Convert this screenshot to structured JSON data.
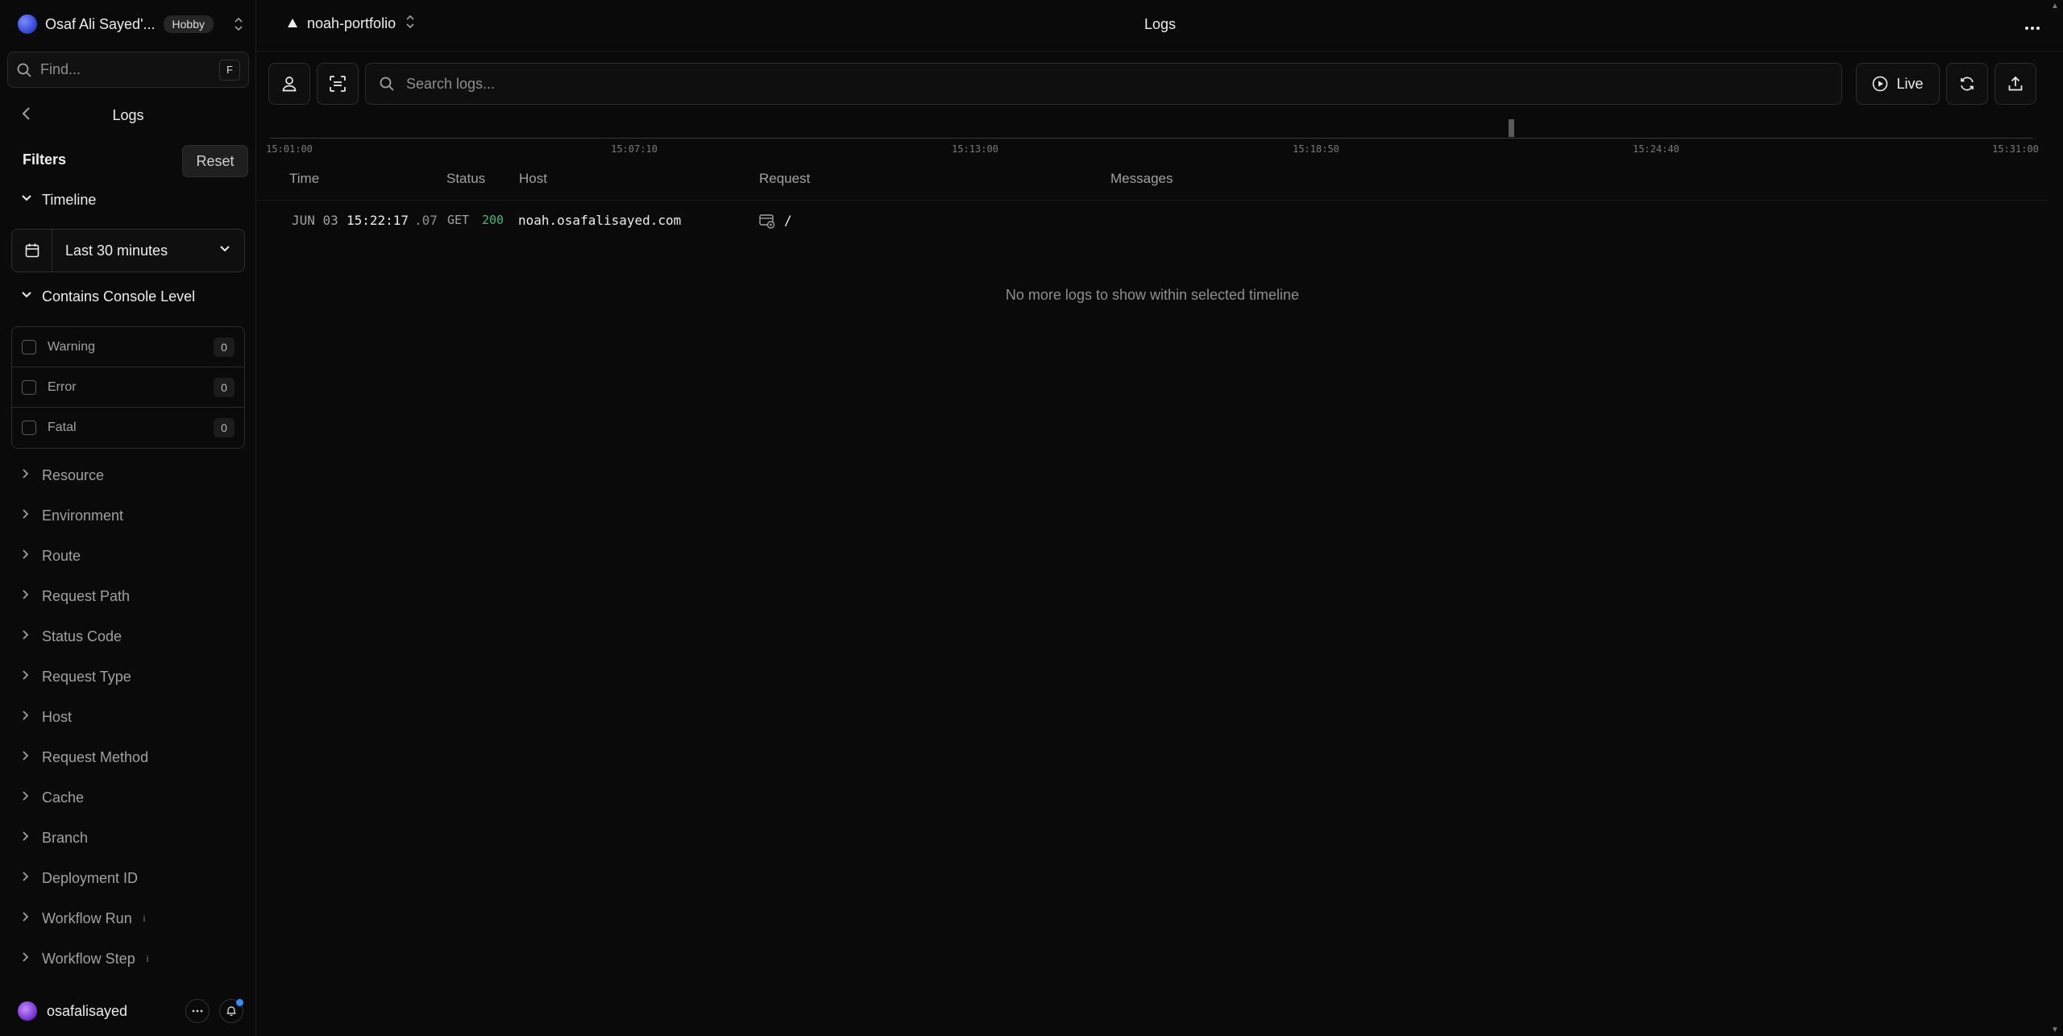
{
  "sidebar": {
    "team_name": "Osaf Ali Sayed'...",
    "plan_badge": "Hobby",
    "find_placeholder": "Find...",
    "find_shortcut": "F",
    "section_title": "Logs",
    "filters_heading": "Filters",
    "reset_label": "Reset",
    "timeline_heading": "Timeline",
    "timeline_value": "Last 30 minutes",
    "console_heading": "Contains Console Level",
    "levels": [
      {
        "label": "Warning",
        "count": "0"
      },
      {
        "label": "Error",
        "count": "0"
      },
      {
        "label": "Fatal",
        "count": "0"
      }
    ],
    "filters": [
      {
        "label": "Resource"
      },
      {
        "label": "Environment"
      },
      {
        "label": "Route"
      },
      {
        "label": "Request Path"
      },
      {
        "label": "Status Code"
      },
      {
        "label": "Request Type"
      },
      {
        "label": "Host"
      },
      {
        "label": "Request Method"
      },
      {
        "label": "Cache"
      },
      {
        "label": "Branch"
      },
      {
        "label": "Deployment ID"
      },
      {
        "label": "Workflow Run",
        "info": "i"
      },
      {
        "label": "Workflow Step",
        "info": "i"
      }
    ],
    "username": "osafalisayed"
  },
  "header": {
    "project_name": "noah-portfolio",
    "page_title": "Logs"
  },
  "toolbar": {
    "search_placeholder": "Search logs...",
    "live_label": "Live"
  },
  "timeline_ticks": [
    "15:01:00",
    "15:07:10",
    "15:13:00",
    "15:18:50",
    "15:24:40",
    "15:31:00"
  ],
  "table": {
    "columns": {
      "time": "Time",
      "status": "Status",
      "host": "Host",
      "request": "Request",
      "messages": "Messages"
    },
    "rows": [
      {
        "date": "JUN 03",
        "time": "15:22:17",
        "ms": ".07",
        "method": "GET",
        "status": "200",
        "host": "noah.osafalisayed.com",
        "path": "/"
      }
    ],
    "empty_message": "No more logs to show within selected timeline"
  },
  "colors": {
    "background": "#0a0a0a",
    "status_ok": "#45b97c",
    "accent_dot": "#3291ff"
  }
}
